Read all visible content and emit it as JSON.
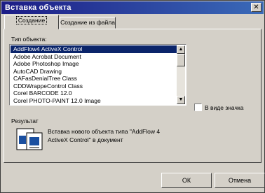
{
  "window": {
    "title": "Вставка объекта",
    "close_glyph": "✕"
  },
  "tabs": [
    {
      "label": "Создание"
    },
    {
      "label": "Создание из файла"
    }
  ],
  "object_type_label": "Тип объекта:",
  "object_types": [
    "AddFlow4 ActiveX Control",
    "Adobe Acrobat Document",
    "Adobe Photoshop Image",
    "AutoCAD Drawing",
    "CAFasDenialTree Class",
    "CDDWrappeControl Class",
    "Corel BARCODE 12.0",
    "Corel PHOTO-PAINT 12.0 Image"
  ],
  "selected_index": 0,
  "scrollbar": {
    "up": "▲",
    "down": "▼"
  },
  "display_as_icon_label": "В виде значка",
  "display_as_icon_checked": false,
  "result": {
    "label": "Результат",
    "line1": "Вставка нового объекта типа \"AddFlow 4",
    "line2": "ActiveX Control\" в документ",
    "icon": "insert-object-icon"
  },
  "buttons": {
    "ok": "ОК",
    "cancel": "Отмена"
  },
  "colors": {
    "titlebar": "#1c1c86",
    "selection": "#0a246a",
    "dialog": "#d4d0c8"
  }
}
